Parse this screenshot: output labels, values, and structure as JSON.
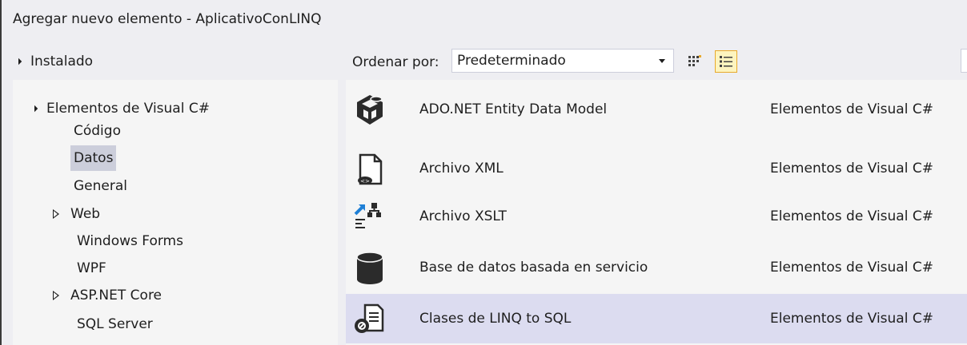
{
  "dialog": {
    "title": "Agregar nuevo elemento - AplicativoConLINQ"
  },
  "left": {
    "installed_label": "Instalado",
    "tree": [
      {
        "label": "Elementos de Visual C#",
        "expander": "expanded",
        "selected": false
      },
      {
        "label": "Código",
        "expander": "none",
        "selected": false
      },
      {
        "label": "Datos",
        "expander": "none",
        "selected": true
      },
      {
        "label": "General",
        "expander": "none",
        "selected": false
      },
      {
        "label": "Web",
        "expander": "collapsed",
        "selected": false
      },
      {
        "label": "Windows Forms",
        "expander": "none",
        "selected": false
      },
      {
        "label": "WPF",
        "expander": "none",
        "selected": false
      },
      {
        "label": "ASP.NET Core",
        "expander": "collapsed",
        "selected": false
      },
      {
        "label": "SQL Server",
        "expander": "none",
        "selected": false
      }
    ]
  },
  "toolbar": {
    "sort_label": "Ordenar por:",
    "sort_value": "Predeterminado",
    "view_modes": [
      "small-icons-view-icon",
      "list-view-icon"
    ],
    "active_view": "list-view-icon"
  },
  "templates": [
    {
      "name": "ADO.NET Entity Data Model",
      "category": "Elementos de Visual C#",
      "icon": "entity-data-model-icon",
      "selected": false
    },
    {
      "name": "Archivo XML",
      "category": "Elementos de Visual C#",
      "icon": "xml-file-icon",
      "selected": false
    },
    {
      "name": "Archivo XSLT",
      "category": "Elementos de Visual C#",
      "icon": "xslt-file-icon",
      "selected": false
    },
    {
      "name": "Base de datos basada en servicio",
      "category": "Elementos de Visual C#",
      "icon": "database-icon",
      "selected": false
    },
    {
      "name": "Clases de LINQ to SQL",
      "category": "Elementos de Visual C#",
      "icon": "linq-to-sql-icon",
      "selected": true
    }
  ],
  "colors": {
    "selection_tree": "#cccedb",
    "selection_list": "#dcdcf0",
    "accent_active_view": "#e8a92c"
  }
}
